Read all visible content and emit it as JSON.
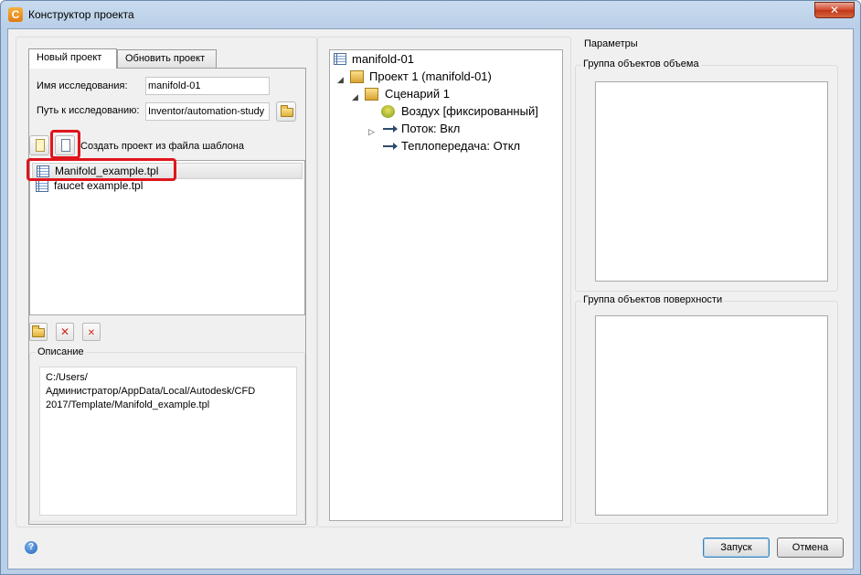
{
  "window": {
    "title": "Конструктор проекта",
    "close_label": "✕"
  },
  "tabs": [
    {
      "label": "Новый проект",
      "active": true
    },
    {
      "label": "Обновить проект",
      "active": false
    }
  ],
  "form": {
    "study_name_label": "Имя исследования:",
    "study_name_value": "manifold-01",
    "study_path_label": "Путь к исследованию:",
    "study_path_value": "Inventor/automation-study"
  },
  "template": {
    "create_label": "Создать проект из файла шаблона",
    "files": [
      {
        "name": "Manifold_example.tpl",
        "selected": true
      },
      {
        "name": "faucet example.tpl",
        "selected": false
      }
    ]
  },
  "description": {
    "title": "Описание",
    "text": "C:/Users/Администратор/AppData/Local/Autodesk/CFD 2017/Template/Manifold_example.tpl"
  },
  "tree": {
    "root": "manifold-01",
    "project": "Проект 1 (manifold-01)",
    "scenario": "Сценарий 1",
    "items": [
      {
        "label": "Воздух [фиксированный]"
      },
      {
        "label": "Поток: Вкл"
      },
      {
        "label": "Теплопередача: Откл"
      }
    ]
  },
  "params": {
    "title": "Параметры",
    "volume_group_title": "Группа объектов объема",
    "surface_group_title": "Группа объектов поверхности"
  },
  "footer": {
    "run_label": "Запуск",
    "cancel_label": "Отмена",
    "help_glyph": "?"
  },
  "colors": {
    "highlight": "#e0141c",
    "title_gradient": "#b9cfe7"
  }
}
